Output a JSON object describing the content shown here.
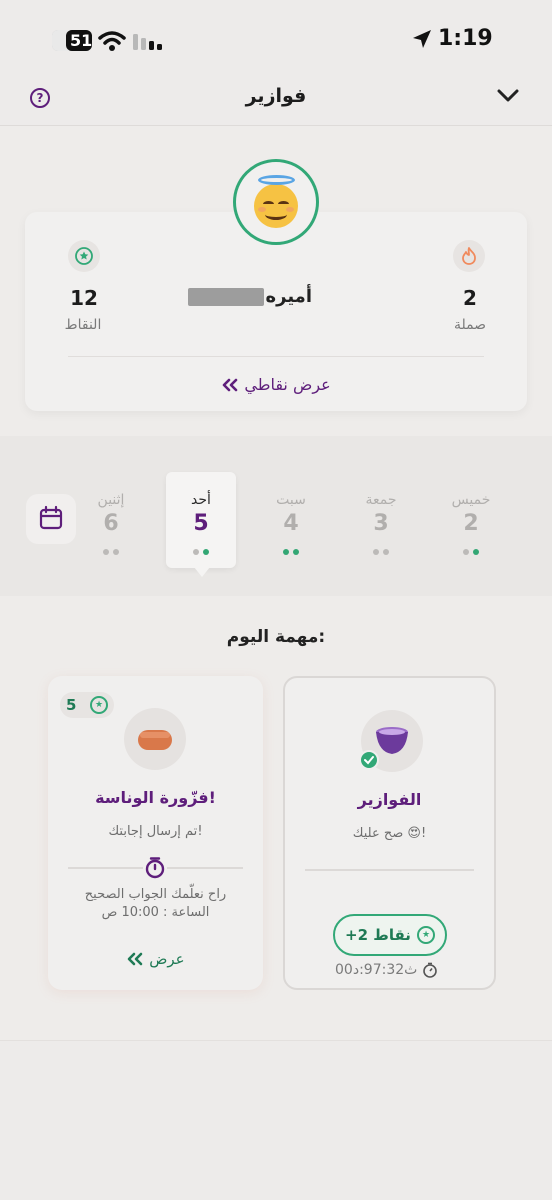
{
  "status_bar": {
    "time": "1:19",
    "battery": "51"
  },
  "header": {
    "title": "فوازير",
    "help_icon": "question-circle-icon",
    "chevron_icon": "chevron-down-icon"
  },
  "profile": {
    "streak": {
      "value": "2",
      "label": "صملة",
      "icon": "flame-icon"
    },
    "points": {
      "value": "12",
      "label": "النقاط",
      "icon": "star-circle-icon"
    },
    "name": "أميره",
    "link_text": "عرض نقاطي"
  },
  "days": [
    {
      "name": "إثنين",
      "num": "6"
    },
    {
      "name": "أحد",
      "num": "5"
    },
    {
      "name": "سبت",
      "num": "4"
    },
    {
      "name": "جمعة",
      "num": "3"
    },
    {
      "name": "خميس",
      "num": "2"
    }
  ],
  "tasks": {
    "title": "مهمة اليوم:",
    "done_card": {
      "name": "الفوازير",
      "subtitle": "صح عليك 😍!",
      "points_label": "+2 نقاط",
      "timer": "ث97:32:د00"
    },
    "riddle_card": {
      "badge_points": "5",
      "name": "فزّورة الوناسة!",
      "subtitle": "تم إرسال إجابتك!",
      "description_1": "راح نعلّمك الجواب الصحيح",
      "description_2": "الساعة : 10:00 ص",
      "view_label": "عرض"
    }
  },
  "colors": {
    "purple": "#5e1e7b",
    "green": "#32a877",
    "orange": "#f08a5d"
  }
}
